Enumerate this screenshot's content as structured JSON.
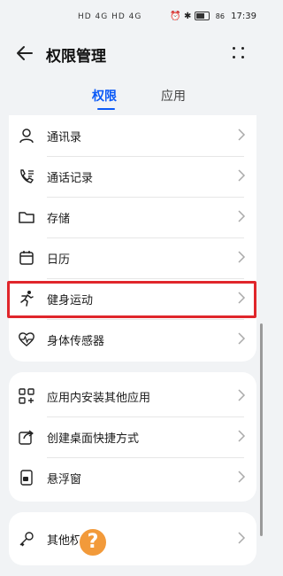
{
  "status_bar": {
    "left_indicators": "HD 4G HD 4G",
    "battery": "86",
    "time": "17:39"
  },
  "header": {
    "title": "权限管理"
  },
  "tabs": [
    {
      "label": "权限",
      "active": true
    },
    {
      "label": "应用",
      "active": false
    }
  ],
  "group1": [
    {
      "label": "通讯录",
      "icon": "contact-icon"
    },
    {
      "label": "通话记录",
      "icon": "call-log-icon"
    },
    {
      "label": "存储",
      "icon": "folder-icon"
    },
    {
      "label": "日历",
      "icon": "calendar-icon"
    },
    {
      "label": "健身运动",
      "icon": "running-icon",
      "highlighted": true
    },
    {
      "label": "身体传感器",
      "icon": "heart-rate-icon"
    }
  ],
  "group2": [
    {
      "label": "应用内安装其他应用",
      "icon": "apps-grid-icon"
    },
    {
      "label": "创建桌面快捷方式",
      "icon": "shortcut-icon"
    },
    {
      "label": "悬浮窗",
      "icon": "floating-window-icon"
    }
  ],
  "group3": [
    {
      "label": "其他权限",
      "icon": "key-icon"
    }
  ],
  "help_badge": "?",
  "colors": {
    "accent": "#0a59f7",
    "highlight_border": "#e0262b",
    "help_badge": "#f29a3a",
    "background": "#f1f3f5"
  }
}
